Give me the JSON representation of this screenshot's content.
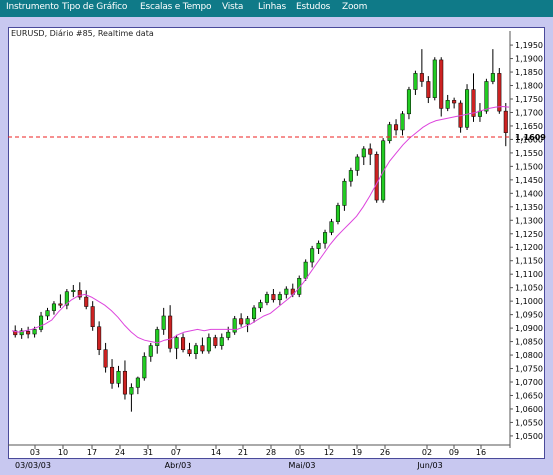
{
  "menu": {
    "items": [
      "Instrumento",
      "Tipo de Gráfico",
      "Escalas e Tempo",
      "Vista",
      "Linhas",
      "Estudos",
      "Zoom"
    ]
  },
  "chart_header": "EURUSD, Diário #85, Realtime data",
  "colors": {
    "menubar": "#0F7A88",
    "background": "#C8C8F0",
    "up_candle": "#22CC22",
    "down_candle": "#CC2222",
    "moving_average": "#DD44DD",
    "price_line": "#EE2222"
  },
  "chart_data": {
    "type": "candlestick",
    "title": "EURUSD, Diário #85, Realtime data",
    "y_ticks": [
      "1,1950",
      "1,1900",
      "1,1850",
      "1,1800",
      "1,1750",
      "1,1700",
      "1,1650",
      "1,1600",
      "1,1550",
      "1,1500",
      "1,1450",
      "1,1400",
      "1,1350",
      "1,1300",
      "1,1250",
      "1,1200",
      "1,1150",
      "1,1100",
      "1,1050",
      "1,1000",
      "1,0950",
      "1,0900",
      "1,0850",
      "1,0800",
      "1,0750",
      "1,0700",
      "1,0650",
      "1,0600",
      "1,0550",
      "1,0500"
    ],
    "ylim": [
      1.047,
      1.198
    ],
    "current_price_label": "1,1609",
    "current_price": 1.1609,
    "x_tick_labels": [
      "03",
      "10",
      "17",
      "24",
      "31",
      "07",
      "14",
      "21",
      "28",
      "05",
      "12",
      "19",
      "26",
      "02",
      "09",
      "16"
    ],
    "month_labels": [
      "03/03/03",
      "Abr/03",
      "Mai/03",
      "Jun/03"
    ],
    "moving_average": [
      1.089,
      1.0885,
      1.089,
      1.0895,
      1.0905,
      1.0915,
      1.093,
      1.096,
      1.0985,
      1.1005,
      1.102,
      1.1025,
      1.1015,
      1.1,
      1.0985,
      1.0965,
      1.094,
      1.091,
      1.0885,
      1.0865,
      1.0855,
      1.085,
      1.0845,
      1.0855,
      1.086,
      1.0875,
      1.0885,
      1.089,
      1.0895,
      1.089,
      1.0895,
      1.0895,
      1.0895,
      1.0895,
      1.0895,
      1.0905,
      1.0915,
      1.093,
      1.0945,
      1.0955,
      1.0975,
      1.0995,
      1.1015,
      1.104,
      1.107,
      1.1105,
      1.114,
      1.1175,
      1.121,
      1.124,
      1.1265,
      1.129,
      1.1315,
      1.135,
      1.139,
      1.1435,
      1.148,
      1.152,
      1.155,
      1.158,
      1.1605,
      1.1625,
      1.1645,
      1.166,
      1.167,
      1.1675,
      1.168,
      1.1685,
      1.169,
      1.1695,
      1.17,
      1.1708,
      1.1715,
      1.172,
      1.1722,
      1.172
    ],
    "candles": [
      {
        "o": 1.089,
        "h": 1.091,
        "l": 1.0865,
        "c": 1.0875
      },
      {
        "o": 1.0875,
        "h": 1.09,
        "l": 1.086,
        "c": 1.089
      },
      {
        "o": 1.0888,
        "h": 1.0905,
        "l": 1.0862,
        "c": 1.0878
      },
      {
        "o": 1.0878,
        "h": 1.0905,
        "l": 1.0865,
        "c": 1.0895
      },
      {
        "o": 1.0895,
        "h": 1.096,
        "l": 1.0885,
        "c": 1.0945
      },
      {
        "o": 1.0945,
        "h": 1.0975,
        "l": 1.093,
        "c": 1.0965
      },
      {
        "o": 1.0965,
        "h": 1.1,
        "l": 1.095,
        "c": 1.099
      },
      {
        "o": 1.099,
        "h": 1.1025,
        "l": 1.0975,
        "c": 1.0985
      },
      {
        "o": 1.0985,
        "h": 1.1045,
        "l": 1.097,
        "c": 1.1035
      },
      {
        "o": 1.1035,
        "h": 1.106,
        "l": 1.1015,
        "c": 1.104
      },
      {
        "o": 1.104,
        "h": 1.107,
        "l": 1.1005,
        "c": 1.1015
      },
      {
        "o": 1.1015,
        "h": 1.104,
        "l": 1.097,
        "c": 1.098
      },
      {
        "o": 1.098,
        "h": 1.1,
        "l": 1.089,
        "c": 1.0905
      },
      {
        "o": 1.0905,
        "h": 1.0925,
        "l": 1.08,
        "c": 1.082
      },
      {
        "o": 1.082,
        "h": 1.0845,
        "l": 1.0735,
        "c": 1.0755
      },
      {
        "o": 1.0755,
        "h": 1.0785,
        "l": 1.0675,
        "c": 1.0695
      },
      {
        "o": 1.0695,
        "h": 1.076,
        "l": 1.068,
        "c": 1.074
      },
      {
        "o": 1.074,
        "h": 1.078,
        "l": 1.0635,
        "c": 1.0655
      },
      {
        "o": 1.0655,
        "h": 1.0695,
        "l": 1.059,
        "c": 1.068
      },
      {
        "o": 1.068,
        "h": 1.072,
        "l": 1.0655,
        "c": 1.0715
      },
      {
        "o": 1.0715,
        "h": 1.081,
        "l": 1.0705,
        "c": 1.0795
      },
      {
        "o": 1.0795,
        "h": 1.0845,
        "l": 1.0775,
        "c": 1.0835
      },
      {
        "o": 1.0835,
        "h": 1.0905,
        "l": 1.0805,
        "c": 1.0895
      },
      {
        "o": 1.0895,
        "h": 1.0975,
        "l": 1.0875,
        "c": 1.0945
      },
      {
        "o": 1.0945,
        "h": 1.0985,
        "l": 1.081,
        "c": 1.0825
      },
      {
        "o": 1.0825,
        "h": 1.0875,
        "l": 1.0785,
        "c": 1.0865
      },
      {
        "o": 1.0865,
        "h": 1.088,
        "l": 1.081,
        "c": 1.082
      },
      {
        "o": 1.082,
        "h": 1.0845,
        "l": 1.0795,
        "c": 1.0805
      },
      {
        "o": 1.0805,
        "h": 1.0845,
        "l": 1.0785,
        "c": 1.0835
      },
      {
        "o": 1.0835,
        "h": 1.0865,
        "l": 1.0805,
        "c": 1.0815
      },
      {
        "o": 1.0815,
        "h": 1.088,
        "l": 1.0805,
        "c": 1.0865
      },
      {
        "o": 1.0865,
        "h": 1.0875,
        "l": 1.0825,
        "c": 1.0835
      },
      {
        "o": 1.0835,
        "h": 1.088,
        "l": 1.082,
        "c": 1.0865
      },
      {
        "o": 1.0865,
        "h": 1.0905,
        "l": 1.0855,
        "c": 1.0885
      },
      {
        "o": 1.0885,
        "h": 1.0945,
        "l": 1.0875,
        "c": 1.0935
      },
      {
        "o": 1.0935,
        "h": 1.0955,
        "l": 1.0905,
        "c": 1.0915
      },
      {
        "o": 1.0915,
        "h": 1.0945,
        "l": 1.0885,
        "c": 1.0935
      },
      {
        "o": 1.0935,
        "h": 1.0985,
        "l": 1.092,
        "c": 1.0975
      },
      {
        "o": 1.0975,
        "h": 1.1005,
        "l": 1.096,
        "c": 1.0995
      },
      {
        "o": 1.0995,
        "h": 1.1035,
        "l": 1.0985,
        "c": 1.1025
      },
      {
        "o": 1.1025,
        "h": 1.1045,
        "l": 1.0995,
        "c": 1.1005
      },
      {
        "o": 1.1005,
        "h": 1.1035,
        "l": 1.0985,
        "c": 1.1025
      },
      {
        "o": 1.1025,
        "h": 1.1055,
        "l": 1.101,
        "c": 1.1045
      },
      {
        "o": 1.1045,
        "h": 1.1065,
        "l": 1.1015,
        "c": 1.1025
      },
      {
        "o": 1.1025,
        "h": 1.1095,
        "l": 1.1015,
        "c": 1.1085
      },
      {
        "o": 1.1085,
        "h": 1.1155,
        "l": 1.1075,
        "c": 1.1145
      },
      {
        "o": 1.1145,
        "h": 1.1205,
        "l": 1.1125,
        "c": 1.1195
      },
      {
        "o": 1.1195,
        "h": 1.1225,
        "l": 1.1175,
        "c": 1.1215
      },
      {
        "o": 1.1215,
        "h": 1.1265,
        "l": 1.1195,
        "c": 1.1255
      },
      {
        "o": 1.1255,
        "h": 1.1305,
        "l": 1.1245,
        "c": 1.1295
      },
      {
        "o": 1.1295,
        "h": 1.1365,
        "l": 1.1285,
        "c": 1.1355
      },
      {
        "o": 1.1355,
        "h": 1.1455,
        "l": 1.1335,
        "c": 1.1445
      },
      {
        "o": 1.1445,
        "h": 1.1495,
        "l": 1.1425,
        "c": 1.1485
      },
      {
        "o": 1.1485,
        "h": 1.1545,
        "l": 1.1465,
        "c": 1.1535
      },
      {
        "o": 1.1535,
        "h": 1.1575,
        "l": 1.1505,
        "c": 1.1565
      },
      {
        "o": 1.1565,
        "h": 1.1585,
        "l": 1.1505,
        "c": 1.1545
      },
      {
        "o": 1.1545,
        "h": 1.1555,
        "l": 1.1365,
        "c": 1.1375
      },
      {
        "o": 1.1375,
        "h": 1.1605,
        "l": 1.1365,
        "c": 1.1595
      },
      {
        "o": 1.1595,
        "h": 1.1665,
        "l": 1.1585,
        "c": 1.1655
      },
      {
        "o": 1.1655,
        "h": 1.1675,
        "l": 1.1615,
        "c": 1.1635
      },
      {
        "o": 1.1635,
        "h": 1.1705,
        "l": 1.1615,
        "c": 1.1695
      },
      {
        "o": 1.1695,
        "h": 1.1795,
        "l": 1.1675,
        "c": 1.1785
      },
      {
        "o": 1.1785,
        "h": 1.1855,
        "l": 1.1765,
        "c": 1.1845
      },
      {
        "o": 1.1845,
        "h": 1.1935,
        "l": 1.1795,
        "c": 1.1815
      },
      {
        "o": 1.1815,
        "h": 1.1835,
        "l": 1.1735,
        "c": 1.1755
      },
      {
        "o": 1.1755,
        "h": 1.1905,
        "l": 1.1745,
        "c": 1.1895
      },
      {
        "o": 1.1895,
        "h": 1.1905,
        "l": 1.1685,
        "c": 1.1715
      },
      {
        "o": 1.1715,
        "h": 1.1765,
        "l": 1.1705,
        "c": 1.1745
      },
      {
        "o": 1.1745,
        "h": 1.1755,
        "l": 1.1715,
        "c": 1.1735
      },
      {
        "o": 1.1735,
        "h": 1.1745,
        "l": 1.1625,
        "c": 1.1645
      },
      {
        "o": 1.1645,
        "h": 1.1805,
        "l": 1.1635,
        "c": 1.1785
      },
      {
        "o": 1.1785,
        "h": 1.1845,
        "l": 1.1665,
        "c": 1.1685
      },
      {
        "o": 1.1685,
        "h": 1.1735,
        "l": 1.1665,
        "c": 1.1705
      },
      {
        "o": 1.1705,
        "h": 1.1825,
        "l": 1.1695,
        "c": 1.1815
      },
      {
        "o": 1.1815,
        "h": 1.1935,
        "l": 1.1805,
        "c": 1.1845
      },
      {
        "o": 1.1845,
        "h": 1.1865,
        "l": 1.1695,
        "c": 1.1705
      },
      {
        "o": 1.1705,
        "h": 1.1735,
        "l": 1.1575,
        "c": 1.1625
      }
    ]
  }
}
